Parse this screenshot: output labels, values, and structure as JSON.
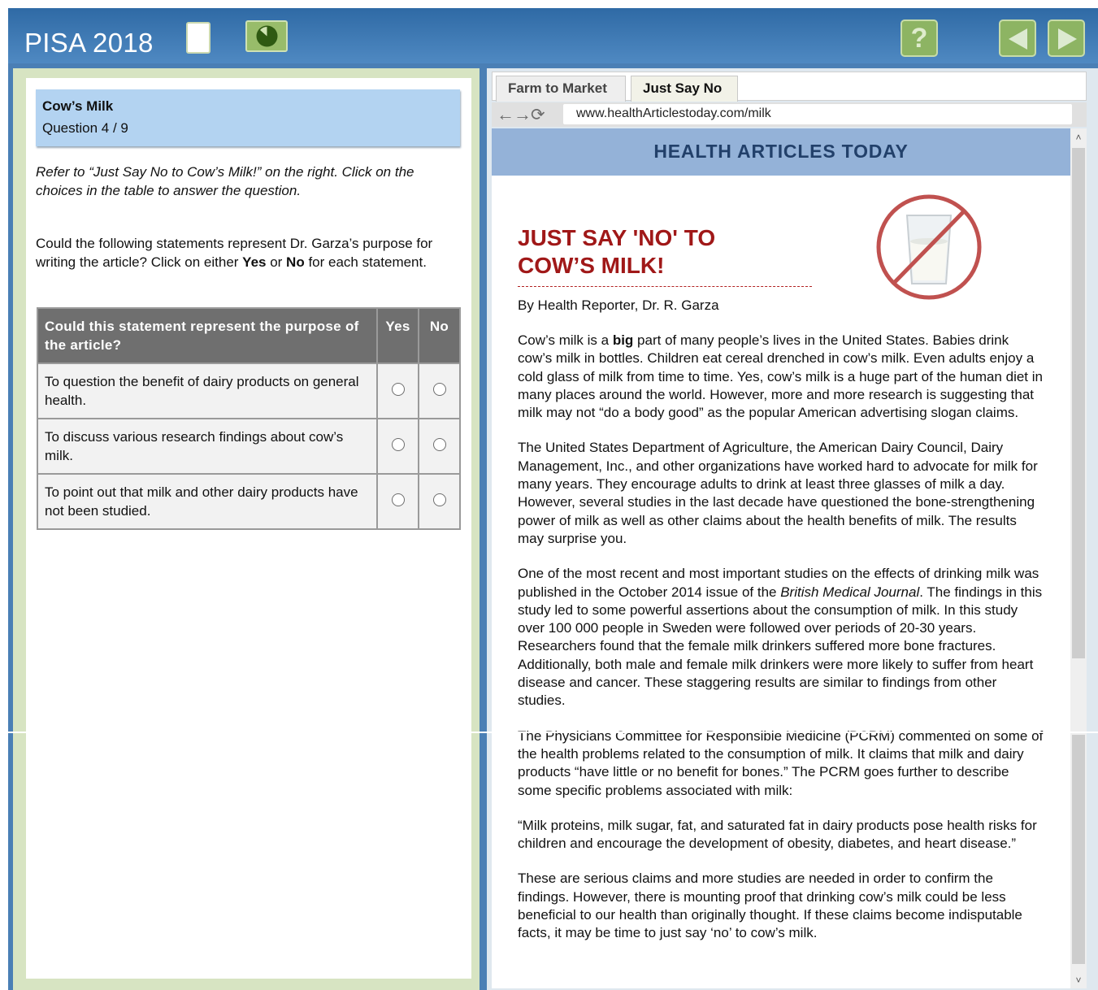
{
  "app": {
    "title": "PISA 2018",
    "help_label": "?"
  },
  "question": {
    "title": "Cow’s Milk",
    "number": "Question 4 / 9",
    "instruction": "Refer to “Just Say No to Cow’s Milk!” on the right. Click on the choices in the table to answer the question.",
    "prompt_part1": "Could the following statements represent Dr. Garza’s purpose for writing the article? Click on either ",
    "prompt_yes": "Yes",
    "prompt_mid": " or ",
    "prompt_no": "No",
    "prompt_part2": " for each statement.",
    "table": {
      "header": "Could this statement represent the purpose of the article?",
      "yes_label": "Yes",
      "no_label": "No",
      "rows": [
        "To question the benefit of dairy products on general health.",
        "To discuss various research findings about cow’s milk.",
        "To point out that milk and other dairy products have not been studied."
      ]
    }
  },
  "browser": {
    "tabs": [
      "Farm to Market",
      "Just Say No"
    ],
    "active_tab": "Just Say No",
    "url": "www.healthArticlestoday.com/milk",
    "site_name": "HEALTH ARTICLES TODAY"
  },
  "article": {
    "headline_line1": "JUST SAY 'NO' TO",
    "headline_line2": "COW’S MILK!",
    "byline": "By Health Reporter, Dr. R. Garza",
    "p1_a": "Cow’s milk is a ",
    "p1_bold": "big",
    "p1_b": " part of many people’s lives in the United States. Babies drink cow’s milk in bottles. Children eat cereal drenched in cow’s milk. Even adults enjoy a cold glass of milk from time to time. Yes, cow’s milk is a huge part of the human diet in many places around the world. However, more and more research is suggesting that milk may not “do a body good” as the popular American advertising slogan claims.",
    "p2": "The United States Department of Agriculture, the American Dairy Council, Dairy Management, Inc., and other organizations have worked hard to advocate for milk for many years. They encourage adults to drink at least three glasses of milk a day. However, several studies in the last decade have questioned the bone-strengthening power of milk as well as other claims about the health benefits of milk. The results may surprise you.",
    "p3_a": "One of the most recent and most important studies on the effects of drinking milk was published in the October 2014 issue of the ",
    "p3_italic": "British Medical Journal",
    "p3_b": ". The findings in this study led to some powerful assertions about the consumption of milk. In this study over 100 000 people in Sweden were followed over periods of 20-30 years. Researchers found that the female milk drinkers suffered more bone fractures. Additionally, both male and female milk drinkers were more likely to suffer from heart disease and cancer. These staggering results are similar to findings from other studies.",
    "p4": "The Physicians Committee for Responsible Medicine (PCRM) commented on some of the health problems related to the consumption of milk. It claims that milk and dairy products “have little or no benefit for bones.” The PCRM goes further to describe some specific problems associated with milk:",
    "p5": "“Milk proteins, milk sugar, fat, and saturated fat in dairy products pose health risks for children and encourage the development of obesity, diabetes, and heart disease.”",
    "p6": "These are serious claims and more studies are needed in order to confirm the findings. However, there is mounting proof that drinking cow’s milk could be less beneficial to our health than originally thought. If these claims become indisputable facts, it may be time to just say ‘no’ to cow’s milk."
  },
  "colors": {
    "topbar": "#3a74ae",
    "button_green": "#8db463",
    "headline_red": "#a01818",
    "banner_blue": "#94b2d8",
    "question_header": "#b3d3f1"
  },
  "icons": [
    "document-icon",
    "timer-icon",
    "help-icon",
    "back-arrow-icon",
    "forward-arrow-icon",
    "no-milk-icon",
    "refresh-icon"
  ]
}
